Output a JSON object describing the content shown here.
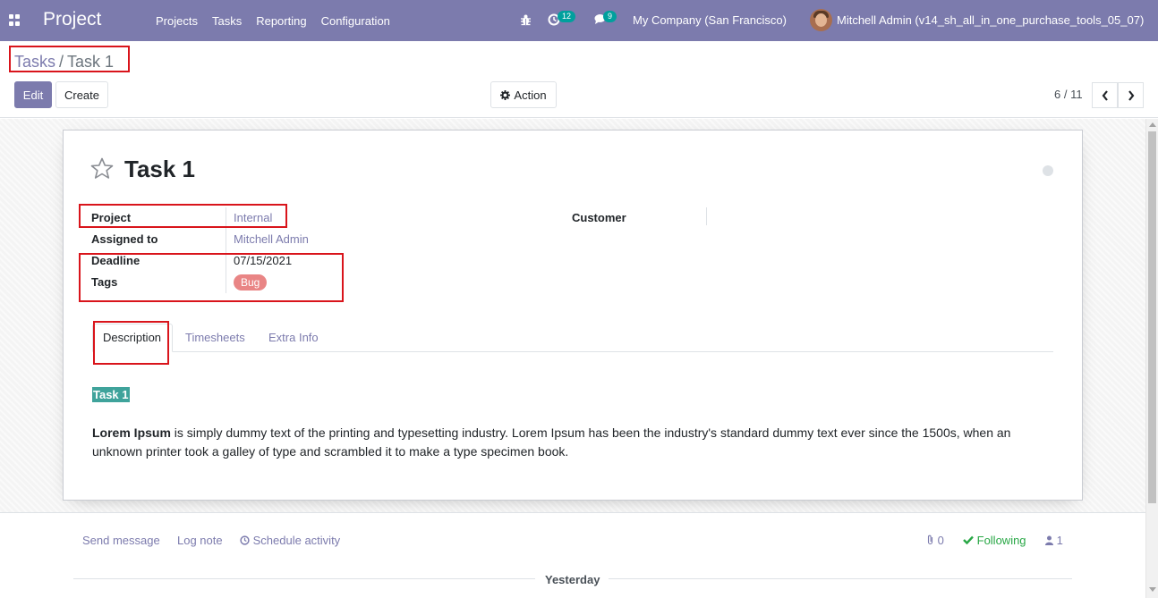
{
  "navbar": {
    "app_title": "Project",
    "menu": [
      "Projects",
      "Tasks",
      "Reporting",
      "Configuration"
    ],
    "activity_count": "12",
    "messages_count": "9",
    "company": "My Company (San Francisco)",
    "user": "Mitchell Admin (v14_sh_all_in_one_purchase_tools_05_07)"
  },
  "breadcrumb": {
    "parent": "Tasks",
    "separator": "/",
    "current": "Task 1"
  },
  "buttons": {
    "edit": "Edit",
    "create": "Create",
    "action": "Action"
  },
  "pager": {
    "value": "6 / 11"
  },
  "task": {
    "title": "Task 1",
    "fields": {
      "project_label": "Project",
      "project_value": "Internal",
      "assigned_label": "Assigned to",
      "assigned_value": "Mitchell Admin",
      "deadline_label": "Deadline",
      "deadline_value": "07/15/2021",
      "tags_label": "Tags",
      "tag": "Bug",
      "customer_label": "Customer",
      "customer_value": ""
    },
    "tabs": [
      "Description",
      "Timesheets",
      "Extra Info"
    ],
    "description": {
      "heading": "Task 1",
      "bold_lead": "Lorem Ipsum",
      "text": " is simply dummy text of the printing and typesetting industry. Lorem Ipsum has been the industry's standard dummy text ever since the 1500s, when an unknown printer took a galley of type and scrambled it to make a type specimen book."
    }
  },
  "chatter": {
    "send_message": "Send message",
    "log_note": "Log note",
    "schedule_activity": "Schedule activity",
    "attachments": "0",
    "following": "Following",
    "followers": "1",
    "day_separator": "Yesterday"
  },
  "colors": {
    "brand": "#7c7bad",
    "highlight": "#3fa39b",
    "tag": "#e98585",
    "following": "#28a745",
    "annotation": "#d9141b"
  }
}
